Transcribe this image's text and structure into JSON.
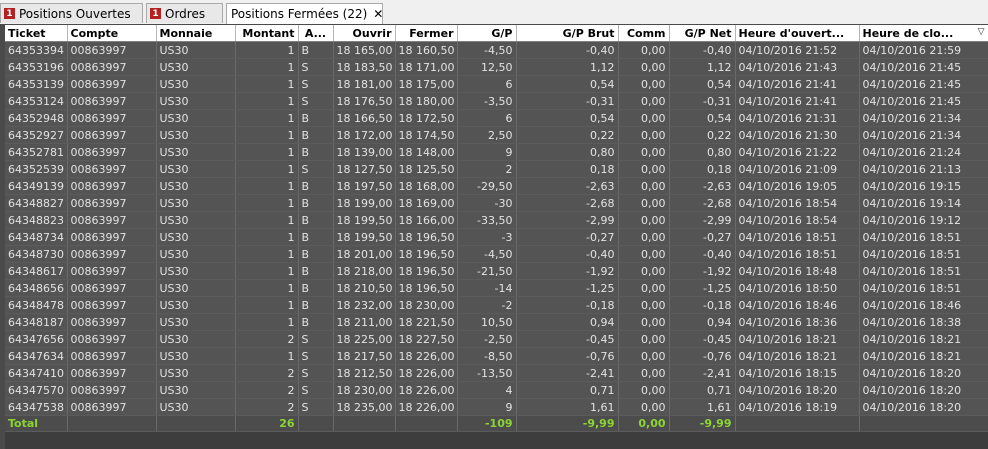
{
  "tabs": [
    {
      "label": "Positions Ouvertes",
      "badge": "1"
    },
    {
      "label": "Ordres",
      "badge": "1"
    },
    {
      "label": "Positions Fermées (22)",
      "close": "✕"
    }
  ],
  "table": {
    "headers": [
      "Ticket",
      "Compte",
      "Monnaie",
      "Montant",
      "A...",
      "Ouvrir",
      "Fermer",
      "G/P",
      "G/P Brut",
      "Comm",
      "G/P Net",
      "Heure d'ouvert...",
      "Heure de clo..."
    ],
    "sort_indicator": "▽",
    "rows": [
      [
        "64353394",
        "00863997",
        "US30",
        "1",
        "B",
        "18 165,00",
        "18 160,50",
        "-4,50",
        "-0,40",
        "0,00",
        "-0,40",
        "04/10/2016 21:52",
        "04/10/2016 21:59"
      ],
      [
        "64353196",
        "00863997",
        "US30",
        "1",
        "S",
        "18 183,50",
        "18 171,00",
        "12,50",
        "1,12",
        "0,00",
        "1,12",
        "04/10/2016 21:43",
        "04/10/2016 21:45"
      ],
      [
        "64353139",
        "00863997",
        "US30",
        "1",
        "S",
        "18 181,00",
        "18 175,00",
        "6",
        "0,54",
        "0,00",
        "0,54",
        "04/10/2016 21:41",
        "04/10/2016 21:45"
      ],
      [
        "64353124",
        "00863997",
        "US30",
        "1",
        "S",
        "18 176,50",
        "18 180,00",
        "-3,50",
        "-0,31",
        "0,00",
        "-0,31",
        "04/10/2016 21:41",
        "04/10/2016 21:45"
      ],
      [
        "64352948",
        "00863997",
        "US30",
        "1",
        "B",
        "18 166,50",
        "18 172,50",
        "6",
        "0,54",
        "0,00",
        "0,54",
        "04/10/2016 21:31",
        "04/10/2016 21:34"
      ],
      [
        "64352927",
        "00863997",
        "US30",
        "1",
        "B",
        "18 172,00",
        "18 174,50",
        "2,50",
        "0,22",
        "0,00",
        "0,22",
        "04/10/2016 21:30",
        "04/10/2016 21:34"
      ],
      [
        "64352781",
        "00863997",
        "US30",
        "1",
        "B",
        "18 139,00",
        "18 148,00",
        "9",
        "0,80",
        "0,00",
        "0,80",
        "04/10/2016 21:22",
        "04/10/2016 21:24"
      ],
      [
        "64352539",
        "00863997",
        "US30",
        "1",
        "S",
        "18 127,50",
        "18 125,50",
        "2",
        "0,18",
        "0,00",
        "0,18",
        "04/10/2016 21:09",
        "04/10/2016 21:13"
      ],
      [
        "64349139",
        "00863997",
        "US30",
        "1",
        "B",
        "18 197,50",
        "18 168,00",
        "-29,50",
        "-2,63",
        "0,00",
        "-2,63",
        "04/10/2016 19:05",
        "04/10/2016 19:15"
      ],
      [
        "64348827",
        "00863997",
        "US30",
        "1",
        "B",
        "18 199,00",
        "18 169,00",
        "-30",
        "-2,68",
        "0,00",
        "-2,68",
        "04/10/2016 18:54",
        "04/10/2016 19:14"
      ],
      [
        "64348823",
        "00863997",
        "US30",
        "1",
        "B",
        "18 199,50",
        "18 166,00",
        "-33,50",
        "-2,99",
        "0,00",
        "-2,99",
        "04/10/2016 18:54",
        "04/10/2016 19:12"
      ],
      [
        "64348734",
        "00863997",
        "US30",
        "1",
        "B",
        "18 199,50",
        "18 196,50",
        "-3",
        "-0,27",
        "0,00",
        "-0,27",
        "04/10/2016 18:51",
        "04/10/2016 18:51"
      ],
      [
        "64348730",
        "00863997",
        "US30",
        "1",
        "B",
        "18 201,00",
        "18 196,50",
        "-4,50",
        "-0,40",
        "0,00",
        "-0,40",
        "04/10/2016 18:51",
        "04/10/2016 18:51"
      ],
      [
        "64348617",
        "00863997",
        "US30",
        "1",
        "B",
        "18 218,00",
        "18 196,50",
        "-21,50",
        "-1,92",
        "0,00",
        "-1,92",
        "04/10/2016 18:48",
        "04/10/2016 18:51"
      ],
      [
        "64348656",
        "00863997",
        "US30",
        "1",
        "B",
        "18 210,50",
        "18 196,50",
        "-14",
        "-1,25",
        "0,00",
        "-1,25",
        "04/10/2016 18:50",
        "04/10/2016 18:51"
      ],
      [
        "64348478",
        "00863997",
        "US30",
        "1",
        "B",
        "18 232,00",
        "18 230,00",
        "-2",
        "-0,18",
        "0,00",
        "-0,18",
        "04/10/2016 18:46",
        "04/10/2016 18:46"
      ],
      [
        "64348187",
        "00863997",
        "US30",
        "1",
        "B",
        "18 211,00",
        "18 221,50",
        "10,50",
        "0,94",
        "0,00",
        "0,94",
        "04/10/2016 18:36",
        "04/10/2016 18:38"
      ],
      [
        "64347656",
        "00863997",
        "US30",
        "2",
        "S",
        "18 225,00",
        "18 227,50",
        "-2,50",
        "-0,45",
        "0,00",
        "-0,45",
        "04/10/2016 18:21",
        "04/10/2016 18:21"
      ],
      [
        "64347634",
        "00863997",
        "US30",
        "1",
        "S",
        "18 217,50",
        "18 226,00",
        "-8,50",
        "-0,76",
        "0,00",
        "-0,76",
        "04/10/2016 18:21",
        "04/10/2016 18:21"
      ],
      [
        "64347410",
        "00863997",
        "US30",
        "2",
        "S",
        "18 212,50",
        "18 226,00",
        "-13,50",
        "-2,41",
        "0,00",
        "-2,41",
        "04/10/2016 18:15",
        "04/10/2016 18:20"
      ],
      [
        "64347570",
        "00863997",
        "US30",
        "2",
        "S",
        "18 230,00",
        "18 226,00",
        "4",
        "0,71",
        "0,00",
        "0,71",
        "04/10/2016 18:20",
        "04/10/2016 18:20"
      ],
      [
        "64347538",
        "00863997",
        "US30",
        "2",
        "S",
        "18 235,00",
        "18 226,00",
        "9",
        "1,61",
        "0,00",
        "1,61",
        "04/10/2016 18:19",
        "04/10/2016 18:20"
      ]
    ],
    "total": [
      "Total",
      "",
      "",
      "26",
      "",
      "",
      "",
      "-109",
      "-9,99",
      "0,00",
      "-9,99",
      "",
      ""
    ]
  }
}
